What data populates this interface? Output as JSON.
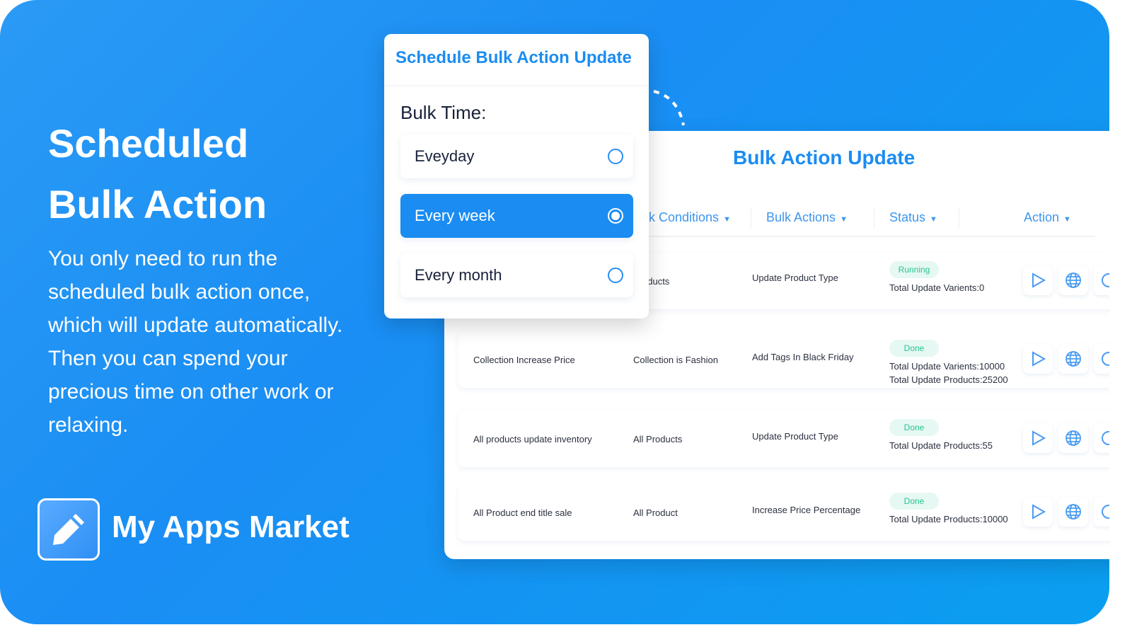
{
  "hero": {
    "title_line1": "Scheduled",
    "title_line2": "Bulk Action",
    "description": "You only need to run the scheduled bulk action once, which will update automatically. Then you can spend your precious time on other work or relaxing.",
    "brand": "My Apps Market",
    "logo_icon": "pencil-icon"
  },
  "modal": {
    "title": "Schedule Bulk Action Update",
    "label": "Bulk Time:",
    "options": [
      {
        "label": "Eveyday",
        "selected": false
      },
      {
        "label": "Every week",
        "selected": true
      },
      {
        "label": "Every month",
        "selected": false
      }
    ]
  },
  "table": {
    "title": "Bulk Action Update",
    "headers": [
      "lk Conditions",
      "Bulk Actions",
      "Status",
      "Action"
    ],
    "rows": [
      {
        "name": "",
        "condition": "Products",
        "action": "Update Product Type",
        "status": "Running",
        "details": [
          "Total Update Varients:0"
        ]
      },
      {
        "name": "Collection Increase Price",
        "condition": "Collection is Fashion",
        "action": "Add Tags In Black Friday",
        "status": "Done",
        "details": [
          "Total Update Varients:10000",
          "Total Update Products:25200"
        ]
      },
      {
        "name": "All products update inventory",
        "condition": "All Products",
        "action": "Update Product Type",
        "status": "Done",
        "details": [
          "Total Update Products:55"
        ]
      },
      {
        "name": "All Product end title sale",
        "condition": "All Product",
        "action": "Increase Price Percentage",
        "status": "Done",
        "details": [
          "Total Update Products:10000"
        ]
      }
    ]
  },
  "colors": {
    "accent": "#1a8cf2",
    "done": "#22c78e",
    "background": "#1a8ef4"
  }
}
